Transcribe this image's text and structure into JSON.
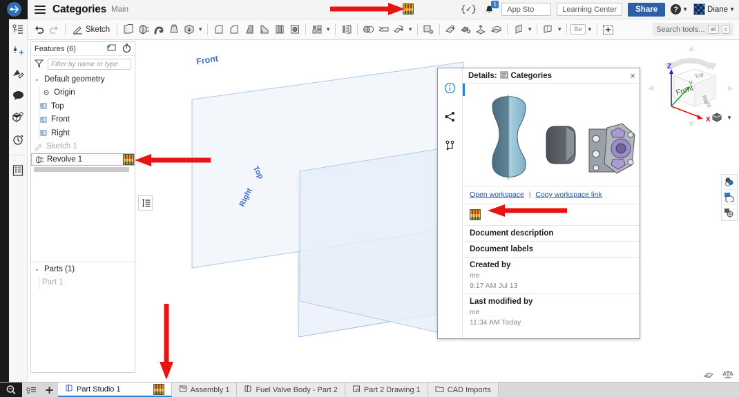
{
  "titlebar": {
    "doc_title": "Categories",
    "branch": "Main",
    "logo": "onshape-logo-icon",
    "menu": "hamburger-menu-icon",
    "doc_thumbnail": "document-thumbnail-icon",
    "featurescript_label": "{✓}",
    "notification_count": "1",
    "app_store_label": "App Sto",
    "learning_center_label": "Learning Center",
    "share_label": "Share",
    "help_label": "?",
    "user_name": "Diane"
  },
  "toolbar": {
    "undo": "undo-icon",
    "redo": "redo-icon",
    "sketch_label": "Sketch",
    "tools": [
      "extrude-icon",
      "revolve-icon",
      "sweep-icon",
      "loft-icon",
      "thicken-icon",
      "fillet-icon",
      "chamfer-icon",
      "draft-icon",
      "rib-icon",
      "shell-icon",
      "hole-icon",
      "pattern-icon",
      "mirror-icon",
      "boolean-icon",
      "split-icon",
      "transform-icon",
      "delete-face-icon",
      "move-face-icon",
      "replace-face-icon",
      "offset-surface-icon",
      "enclose-icon",
      "sheet-metal-icon",
      "variable-icon",
      "insert-icon"
    ],
    "search_placeholder": "Search tools...",
    "search_kbd_alt": "alt",
    "search_kbd_key": "c"
  },
  "left_rail": {
    "items": [
      "feature-list-icon",
      "add-variable-icon",
      "sketch-pencil-icon",
      "comment-icon",
      "part-instance-icon",
      "history-icon",
      "bill-of-materials-icon"
    ]
  },
  "feature_tree": {
    "header": "Features (6)",
    "header_icons": [
      "add-folder-icon",
      "timer-icon"
    ],
    "filter_icon": "filter-funnel-icon",
    "filter_placeholder": "Filter by name or type",
    "groups": [
      {
        "label": "Default geometry",
        "expanded": true,
        "items": [
          {
            "label": "Origin",
            "icon": "origin-icon",
            "state": "normal"
          },
          {
            "label": "Top",
            "icon": "plane-icon",
            "state": "normal"
          },
          {
            "label": "Front",
            "icon": "plane-icon",
            "state": "normal"
          },
          {
            "label": "Right",
            "icon": "plane-icon",
            "state": "normal"
          }
        ]
      }
    ],
    "features": [
      {
        "label": "Sketch 1",
        "icon": "sketch-icon",
        "state": "dim",
        "selected": false,
        "thumb": false
      },
      {
        "label": "Revolve 1",
        "icon": "revolve-feature-icon",
        "state": "normal",
        "selected": true,
        "thumb": true
      }
    ],
    "rollback_icon": "rollback-bar-icon",
    "parts_header": "Parts (1)",
    "parts": [
      {
        "label": "Part 1",
        "icon": "part-icon"
      }
    ]
  },
  "viewport": {
    "planes": [
      {
        "label": "Front"
      },
      {
        "label": "Top"
      },
      {
        "label": "Right"
      }
    ],
    "viewcube": {
      "faces": [
        "Front",
        "Top",
        "Right"
      ],
      "axes": [
        {
          "label": "Z",
          "color": "#2020e0"
        },
        {
          "label": "Y",
          "color": "#12a012"
        },
        {
          "label": "X",
          "color": "#e01010"
        }
      ]
    },
    "view_menu_icon": "view-cube-menu-icon",
    "right_tools": [
      "appearance-icon",
      "display-state-icon",
      "render-icon"
    ],
    "corner_tools": [
      "measure-icon",
      "mass-properties-icon"
    ]
  },
  "details_panel": {
    "title_prefix": "Details:",
    "title": "Categories",
    "title_icon": "document-icon",
    "close_icon": "close-icon",
    "rail_icons": [
      "info-icon",
      "share-node-icon",
      "branch-icon"
    ],
    "preview_alt": "part-preview-render",
    "open_workspace_label": "Open workspace",
    "separator": "|",
    "copy_link_label": "Copy workspace link",
    "thumbnail_icon": "document-thumbnail-icon",
    "sections": [
      {
        "header": "Document description",
        "value": "",
        "date": ""
      },
      {
        "header": "Document labels",
        "value": "",
        "date": ""
      },
      {
        "header": "Created by",
        "value": "me",
        "date": "9:17 AM Jul 13"
      },
      {
        "header": "Last modified by",
        "value": "me",
        "date": "11:34 AM Today"
      }
    ]
  },
  "tabbar": {
    "search_icon": "tab-search-icon",
    "list_icon": "tab-list-icon",
    "add_icon": "add-tab-icon",
    "tabs": [
      {
        "label": "Part Studio 1",
        "icon": "part-studio-icon",
        "active": true,
        "thumb": true
      },
      {
        "label": "Assembly 1",
        "icon": "assembly-icon",
        "active": false,
        "thumb": false
      },
      {
        "label": "Fuel Valve Body - Part 2",
        "icon": "part-studio-icon",
        "active": false,
        "thumb": false
      },
      {
        "label": "Part 2 Drawing 1",
        "icon": "drawing-icon",
        "active": false,
        "thumb": false
      },
      {
        "label": "CAD Imports",
        "icon": "folder-icon",
        "active": false,
        "thumb": false
      }
    ]
  },
  "annotations": {
    "arrow_color": "#e81313",
    "arrows": [
      {
        "target": "titlebar-document-thumbnail"
      },
      {
        "target": "feature-revolve1-thumbnail"
      },
      {
        "target": "details-panel-thumbnail"
      },
      {
        "target": "tab-part-studio-thumbnail"
      }
    ]
  }
}
